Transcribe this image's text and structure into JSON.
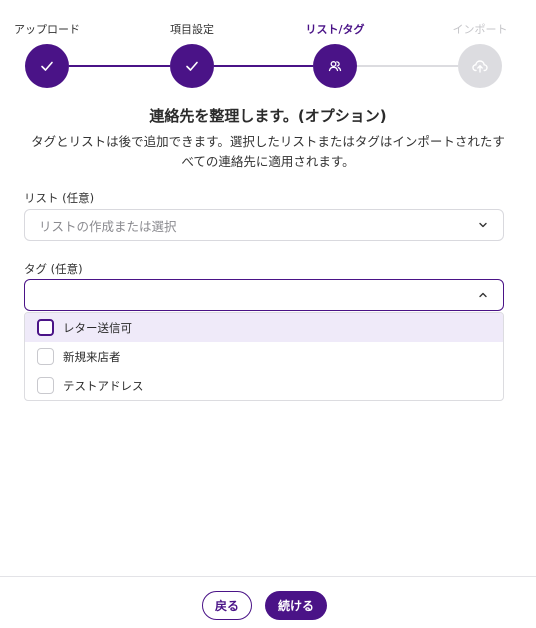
{
  "stepper": {
    "steps": [
      {
        "label": "アップロード",
        "state": "done",
        "icon": "check-icon"
      },
      {
        "label": "項目設定",
        "state": "done",
        "icon": "check-icon"
      },
      {
        "label": "リスト/タグ",
        "state": "active",
        "icon": "users-icon"
      },
      {
        "label": "インポート",
        "state": "disabled",
        "icon": "cloud-upload-icon"
      }
    ]
  },
  "main": {
    "title": "連絡先を整理します。(オプション)",
    "description": "タグとリストは後で追加できます。選択したリストまたはタグはインポートされたすべての連絡先に適用されます。"
  },
  "list_field": {
    "label": "リスト (任意)",
    "placeholder": "リストの作成または選択"
  },
  "tag_field": {
    "label": "タグ (任意)",
    "value": "",
    "options": [
      {
        "label": "レター送信可",
        "checked": false
      },
      {
        "label": "新規来店者",
        "checked": false
      },
      {
        "label": "テストアドレス",
        "checked": false
      }
    ]
  },
  "footer": {
    "back_label": "戻る",
    "next_label": "続ける"
  },
  "colors": {
    "accent": "#4a1387",
    "disabled": "#dcdce0",
    "highlight": "#efeaf9"
  }
}
